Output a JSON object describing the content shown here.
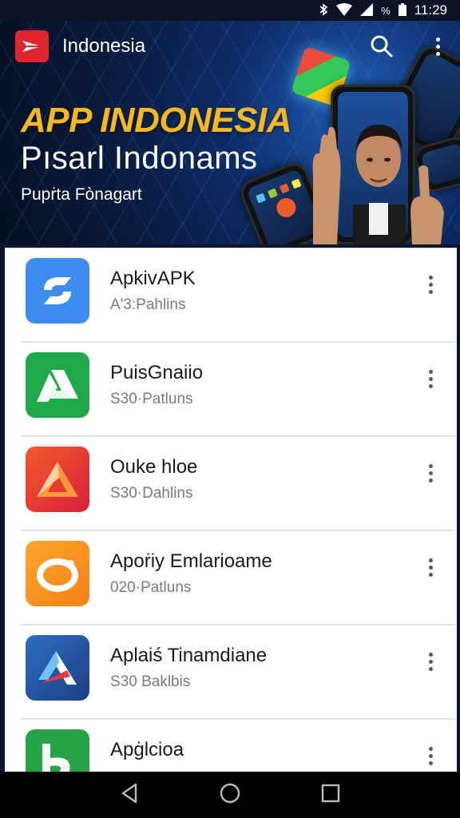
{
  "status_bar": {
    "time": "11:29",
    "icons": [
      "bluetooth-icon",
      "wifi-icon",
      "signal-icon",
      "battery-icon"
    ],
    "battery_label": "%"
  },
  "app_bar": {
    "title": "Indonesia",
    "logo_icon": "play-logo-icon",
    "search_icon": "search-icon",
    "menu_icon": "more-vert-icon"
  },
  "banner": {
    "title": "APP INDONESIA",
    "subtitle": "Pısarl Indonams",
    "caption": "Pupṙta Fònagart"
  },
  "apps": [
    {
      "name": "ApkivAPK",
      "meta": "A'3:Pahlins",
      "icon": "sync-app-icon",
      "color": "#3d8df0"
    },
    {
      "name": "PuisGnaiio",
      "meta": "S30·Patluns",
      "icon": "drive-app-icon",
      "color": "#1fa84a"
    },
    {
      "name": "Ouke hloe",
      "meta": "S30·Dahlins",
      "icon": "triangle-app-icon",
      "color": "#e63a2c"
    },
    {
      "name": "Apoṙiy Emlarioame",
      "meta": "020·Patluns",
      "icon": "ring-app-icon",
      "color": "#f7931e"
    },
    {
      "name": "Aplaiś Tinamdiane",
      "meta": "S30 Baklbis",
      "icon": "arrow-app-icon",
      "color": "#2358a8"
    },
    {
      "name": "Apġlcioa",
      "meta": "",
      "icon": "b-app-icon",
      "color": "#27a347"
    }
  ],
  "nav_bar": {
    "back_icon": "back-icon",
    "home_icon": "home-icon",
    "recents_icon": "recents-icon"
  }
}
